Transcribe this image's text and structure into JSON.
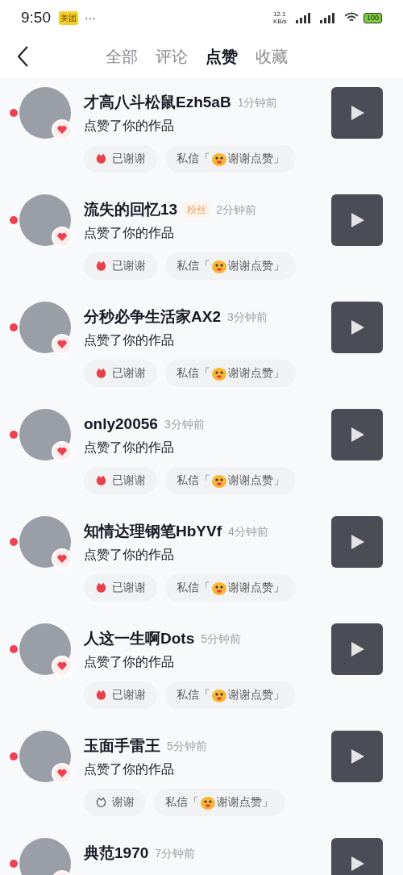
{
  "status_bar": {
    "time": "9:50",
    "app_badge": "美团",
    "more": "···",
    "speed": "12.1 KB/s",
    "battery": "100"
  },
  "tabs": [
    {
      "label": "全部",
      "selected": false
    },
    {
      "label": "评论",
      "selected": false
    },
    {
      "label": "点赞",
      "selected": true
    },
    {
      "label": "收藏",
      "selected": false
    }
  ],
  "notifications": [
    {
      "name": "才高八斗松鼠Ezh5aB",
      "time": "1分钟前",
      "action": "点赞了你的作品",
      "thank_label": "已谢谢",
      "thanked": true,
      "dm_prefix": "私信「",
      "dm_text": "谢谢点赞」"
    },
    {
      "name": "流失的回忆13",
      "tag": "粉丝",
      "time": "2分钟前",
      "action": "点赞了你的作品",
      "thank_label": "已谢谢",
      "thanked": true,
      "dm_prefix": "私信「",
      "dm_text": "谢谢点赞」"
    },
    {
      "name": "分秒必争生活家AX2",
      "time": "3分钟前",
      "action": "点赞了你的作品",
      "thank_label": "已谢谢",
      "thanked": true,
      "dm_prefix": "私信「",
      "dm_text": "谢谢点赞」"
    },
    {
      "name": "only20056",
      "time": "3分钟前",
      "action": "点赞了你的作品",
      "thank_label": "已谢谢",
      "thanked": true,
      "dm_prefix": "私信「",
      "dm_text": "谢谢点赞」"
    },
    {
      "name": "知情达理钢笔HbYVf",
      "time": "4分钟前",
      "action": "点赞了你的作品",
      "thank_label": "已谢谢",
      "thanked": true,
      "dm_prefix": "私信「",
      "dm_text": "谢谢点赞」"
    },
    {
      "name": "人这一生啊Dots",
      "time": "5分钟前",
      "action": "点赞了你的作品",
      "thank_label": "已谢谢",
      "thanked": true,
      "dm_prefix": "私信「",
      "dm_text": "谢谢点赞」"
    },
    {
      "name": "玉面手雷王",
      "time": "5分钟前",
      "action": "点赞了你的作品",
      "thank_label": "谢谢",
      "thanked": false,
      "dm_prefix": "私信「",
      "dm_text": "谢谢点赞」"
    },
    {
      "name": "典范1970",
      "time": "7分钟前"
    }
  ]
}
